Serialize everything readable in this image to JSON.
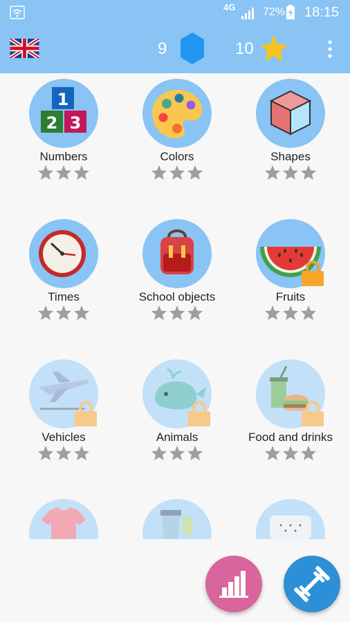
{
  "status_bar": {
    "network": "4G",
    "battery": "72%",
    "time": "18:15"
  },
  "header": {
    "language_icon": "uk-flag-icon",
    "gems": "9",
    "stars": "10"
  },
  "categories": [
    {
      "label": "Numbers",
      "locked": false,
      "stars_earned": 0,
      "stars_total": 3
    },
    {
      "label": "Colors",
      "locked": false,
      "stars_earned": 0,
      "stars_total": 3
    },
    {
      "label": "Shapes",
      "locked": false,
      "stars_earned": 0,
      "stars_total": 3
    },
    {
      "label": "Times",
      "locked": false,
      "stars_earned": 0,
      "stars_total": 3
    },
    {
      "label": "School objects",
      "locked": false,
      "stars_earned": 0,
      "stars_total": 3
    },
    {
      "label": "Fruits",
      "locked": true,
      "stars_earned": 0,
      "stars_total": 3
    },
    {
      "label": "Vehicles",
      "locked": true,
      "stars_earned": 0,
      "stars_total": 3
    },
    {
      "label": "Animals",
      "locked": true,
      "stars_earned": 0,
      "stars_total": 3
    },
    {
      "label": "Food and drinks",
      "locked": true,
      "stars_earned": 0,
      "stars_total": 3
    }
  ],
  "fabs": {
    "stats_icon": "bar-chart-icon",
    "practice_icon": "dumbbell-icon"
  },
  "colors": {
    "primary": "#89c4f4",
    "stats_fab": "#d8659c",
    "practice_fab": "#2d8fd5",
    "star_empty": "#9e9e9e",
    "star_gold": "#f7c31c",
    "gem": "#2196f3"
  }
}
